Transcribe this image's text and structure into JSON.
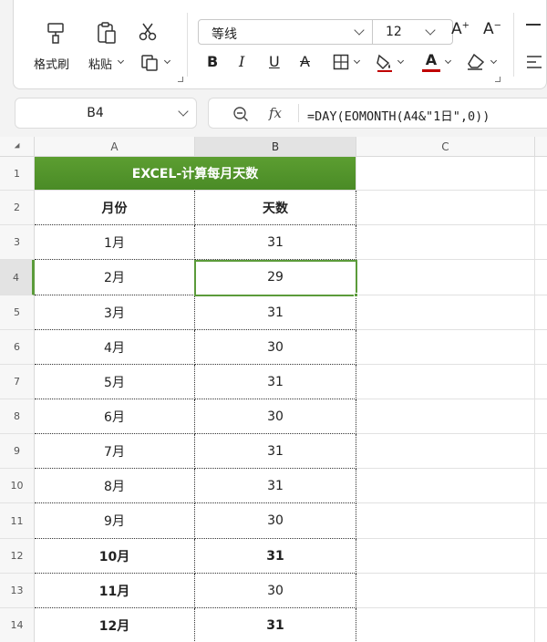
{
  "ribbon": {
    "format_painter_label": "格式刷",
    "paste_label": "粘贴",
    "font_name": "等线",
    "font_size": "12",
    "bold_label": "B",
    "italic_label": "I",
    "underline_label": "U",
    "strike_label": "A",
    "font_color_label": "A"
  },
  "formula_bar": {
    "name_box": "B4",
    "formula": "=DAY(EOMONTH(A4&\"1日\",0))"
  },
  "columns": [
    "A",
    "B",
    "C"
  ],
  "rows": [
    "1",
    "2",
    "3",
    "4",
    "5",
    "6",
    "7",
    "8",
    "9",
    "10",
    "11",
    "12",
    "13",
    "14"
  ],
  "sheet": {
    "title": "EXCEL-计算每月天数",
    "header": {
      "month": "月份",
      "days": "天数"
    },
    "data": [
      {
        "month": "1月",
        "days": "31"
      },
      {
        "month": "2月",
        "days": "29"
      },
      {
        "month": "3月",
        "days": "31"
      },
      {
        "month": "4月",
        "days": "30"
      },
      {
        "month": "5月",
        "days": "31"
      },
      {
        "month": "6月",
        "days": "30"
      },
      {
        "month": "7月",
        "days": "31"
      },
      {
        "month": "8月",
        "days": "31"
      },
      {
        "month": "9月",
        "days": "30"
      },
      {
        "month": "10月",
        "days": "31"
      },
      {
        "month": "11月",
        "days": "30"
      },
      {
        "month": "12月",
        "days": "31"
      }
    ]
  },
  "colors": {
    "accent_green": "#5b9b3a",
    "font_color_bar": "#c00000"
  }
}
